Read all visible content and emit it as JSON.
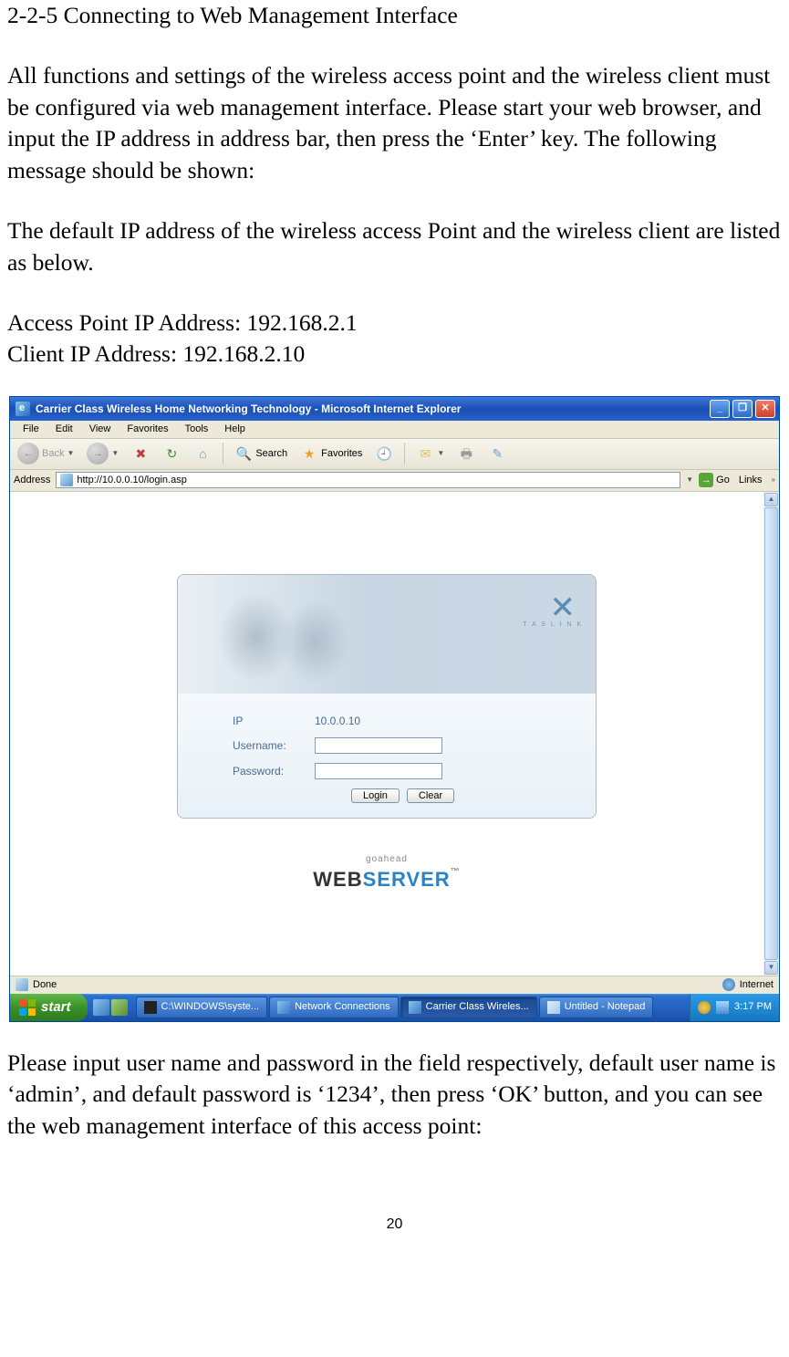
{
  "doc": {
    "section_title": "2-2-5 Connecting to Web Management Interface",
    "para1": "All functions and settings of the wireless access point and the wireless client must be configured via web management interface. Please start your web browser, and input the IP address in address bar, then press the ‘Enter’ key. The following message should be shown:",
    "para2": "The default IP address of the wireless access Point and the wireless client are listed as below.",
    "ap_ip_line": "Access Point IP Address: 192.168.2.1",
    "client_ip_line": "Client IP Address: 192.168.2.10",
    "para3": "Please input user name and password in the field respectively, default user name is ‘admin’, and default password is ‘1234’, then press ‘OK’ button, and you can see the web management interface of this access point:",
    "page_number": "20"
  },
  "browser": {
    "title": "Carrier Class Wireless Home Networking Technology - Microsoft Internet Explorer",
    "menus": [
      "File",
      "Edit",
      "View",
      "Favorites",
      "Tools",
      "Help"
    ],
    "toolbar": {
      "back": "Back",
      "search": "Search",
      "favorites": "Favorites"
    },
    "address_label": "Address",
    "address_value": "http://10.0.0.10/login.asp",
    "go_label": "Go",
    "links_label": "Links",
    "status_done": "Done",
    "status_zone": "Internet"
  },
  "login": {
    "brand_sub": "T A S L I N K",
    "ip_label": "IP",
    "ip_value": "10.0.0.10",
    "username_label": "Username:",
    "password_label": "Password:",
    "login_btn": "Login",
    "clear_btn": "Clear",
    "ws_goahead": "goahead",
    "ws_web": "WEB",
    "ws_server": "SERVER"
  },
  "taskbar": {
    "start": "start",
    "items": [
      {
        "label": "C:\\WINDOWS\\syste...",
        "active": false
      },
      {
        "label": "Network Connections",
        "active": false
      },
      {
        "label": "Carrier Class Wireles...",
        "active": true
      },
      {
        "label": "Untitled - Notepad",
        "active": false
      }
    ],
    "clock": "3:17 PM"
  }
}
